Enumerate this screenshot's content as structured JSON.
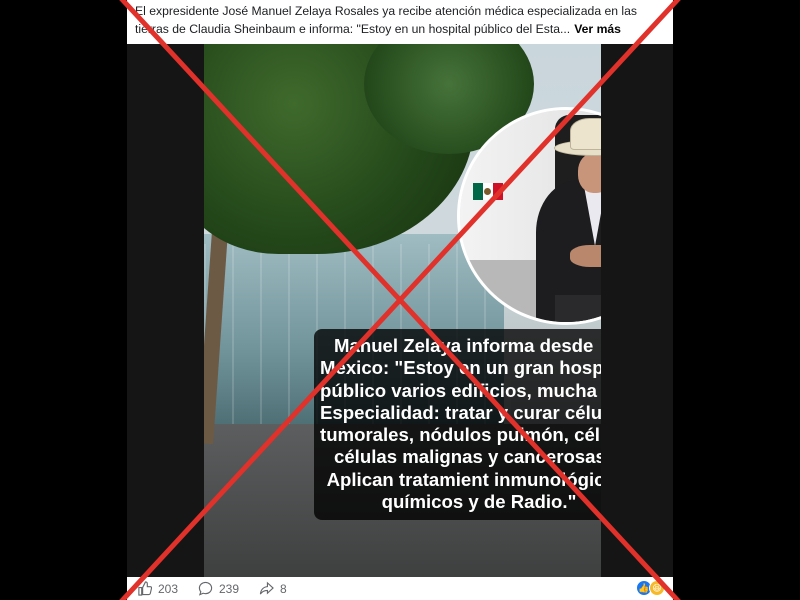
{
  "post": {
    "caption": "El expresidente José Manuel Zelaya Rosales ya recibe atención médica especializada en las tierras de Claudia Sheinbaum e informa: \"Estoy en un hospital público del Esta...",
    "see_more": "Ver más"
  },
  "image_text": {
    "line1": "Manuel Zelaya informa desde",
    "line2": "México: \"Estoy en un gran hospital",
    "line3": "público varios edificios, mucha fama.",
    "line4": "Especialidad: tratar y curar células",
    "line5": "tumorales, nódulos pulmón, células",
    "line6": "células malignas y cancerosas.",
    "line7": "Aplican tratamient inmunológicos,",
    "line8": "químicos y de Radio.\""
  },
  "footer": {
    "likes": "203",
    "comments": "239",
    "shares": "8"
  },
  "colors": {
    "cross": "#e0312b",
    "like_blue": "#1877f2",
    "haha_yellow": "#f7b928",
    "flag_green": "#006847",
    "flag_red": "#ce1126"
  }
}
